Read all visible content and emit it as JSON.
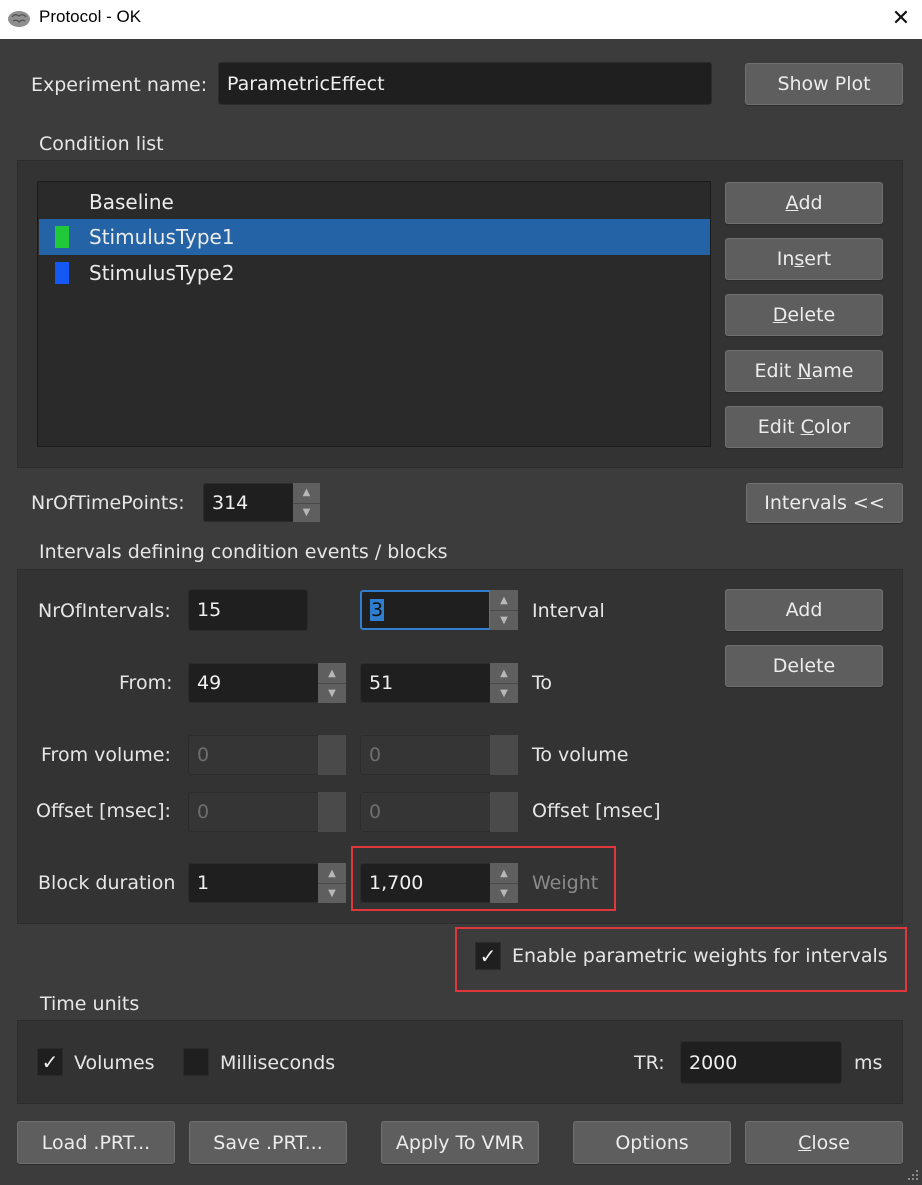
{
  "window": {
    "title": "Protocol - OK",
    "close_glyph": "✕"
  },
  "experiment": {
    "label": "Experiment name:",
    "value": "ParametricEffect",
    "show_plot": "Show Plot"
  },
  "conditions": {
    "group_label": "Condition list",
    "items": [
      {
        "label": "Baseline",
        "color": "#2a2a2a",
        "selected": false
      },
      {
        "label": "StimulusType1",
        "color": "#1fc93a",
        "selected": true
      },
      {
        "label": "StimulusType2",
        "color": "#1559f5",
        "selected": false
      }
    ],
    "buttons": {
      "add": {
        "pre": "",
        "u": "A",
        "post": "dd"
      },
      "insert": {
        "pre": "In",
        "u": "s",
        "post": "ert"
      },
      "delete": {
        "pre": "",
        "u": "D",
        "post": "elete"
      },
      "edit_name": {
        "pre": "Edit ",
        "u": "N",
        "post": "ame"
      },
      "edit_color": {
        "pre": "Edit ",
        "u": "C",
        "post": "olor"
      }
    }
  },
  "timepoints": {
    "label": "NrOfTimePoints:",
    "value": "314",
    "intervals_button": "Intervals <<"
  },
  "intervals": {
    "group_label": "Intervals defining condition events / blocks",
    "nr_label": "NrOfIntervals:",
    "nr_value": "15",
    "current_value": "3",
    "interval_label": "Interval",
    "add_button": "Add",
    "delete_button": "Delete",
    "from_label": "From:",
    "from_value": "49",
    "to_value": "51",
    "to_label": "To",
    "from_volume_label": "From volume:",
    "from_volume_value": "0",
    "to_volume_value": "0",
    "to_volume_label": "To volume",
    "offset_label_left": "Offset [msec]:",
    "offset_value_left": "0",
    "offset_value_right": "0",
    "offset_label_right": "Offset [msec]",
    "block_label": "Block duration",
    "block_value": "1",
    "weight_value": "1,700",
    "weight_label": "Weight"
  },
  "parametric": {
    "checked": true,
    "label": "Enable parametric weights for intervals"
  },
  "time_units": {
    "group_label": "Time units",
    "volumes_label": "Volumes",
    "volumes_checked": true,
    "ms_label": "Milliseconds",
    "ms_checked": false,
    "tr_label": "TR:",
    "tr_value": "2000",
    "tr_unit": "ms"
  },
  "bottom": {
    "load": "Load .PRT...",
    "save": "Save .PRT...",
    "apply": "Apply To VMR",
    "options": "Options",
    "close": {
      "pre": "",
      "u": "C",
      "post": "lose"
    }
  },
  "colors": {
    "accent": "#2463a5",
    "highlight_border": "#e0363c"
  }
}
